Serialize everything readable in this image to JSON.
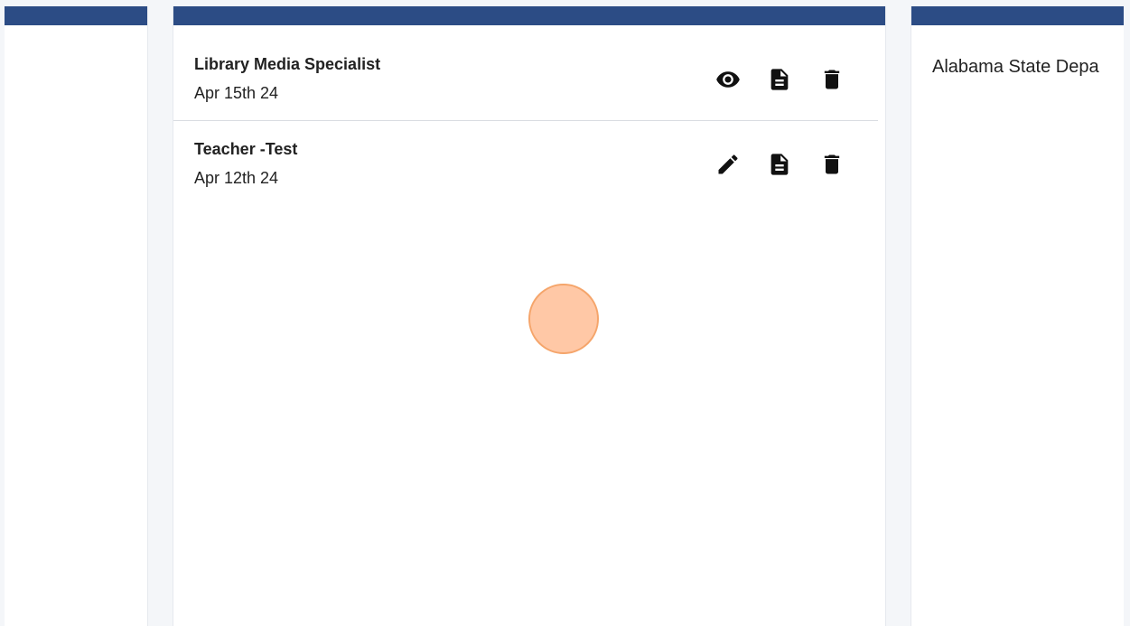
{
  "items": [
    {
      "title": "Library Media Specialist",
      "date": "Apr 15th 24",
      "actions": [
        "eye-icon",
        "document-icon",
        "trash-icon"
      ]
    },
    {
      "title": "Teacher -Test",
      "date": "Apr 12th 24",
      "actions": [
        "pencil-icon",
        "document-icon",
        "trash-icon"
      ]
    }
  ],
  "right_panel": {
    "org_name": "Alabama State Depa"
  },
  "colors": {
    "header": "#2c4c85",
    "background": "#f4f6f9",
    "click_marker": "#ffbe96"
  }
}
